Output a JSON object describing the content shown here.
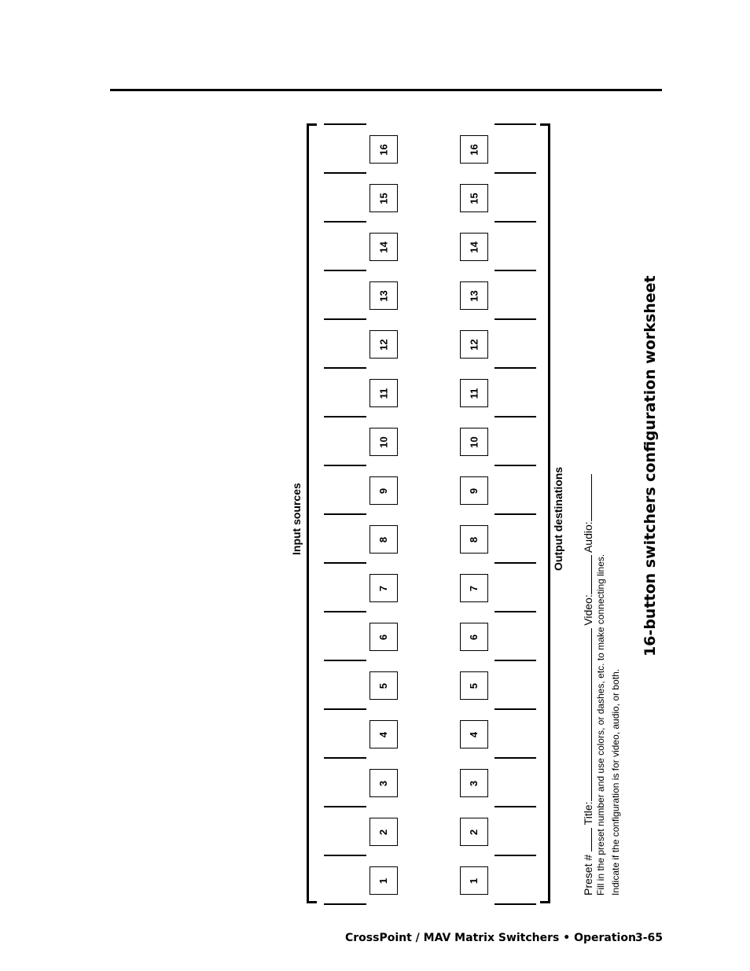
{
  "page": {
    "title": "16-button switchers configuration worksheet",
    "footer_text": "CrossPoint / MAV Matrix Switchers • Operation",
    "page_number": "3-65"
  },
  "worksheet": {
    "input_label": "Input  sources",
    "output_label": "Output destinations",
    "input_buttons": [
      "16",
      "15",
      "14",
      "13",
      "12",
      "11",
      "10",
      "9",
      "8",
      "7",
      "6",
      "5",
      "4",
      "3",
      "2",
      "1"
    ],
    "output_buttons": [
      "16",
      "15",
      "14",
      "13",
      "12",
      "11",
      "10",
      "9",
      "8",
      "7",
      "6",
      "5",
      "4",
      "3",
      "2",
      "1"
    ],
    "preset_label": "Preset #",
    "title_label": "Title:",
    "video_label": "Video:",
    "audio_label": "Audio:",
    "instruction_1": "Fill in the preset number and use colors, or dashes, etc. to make connecting lines.",
    "instruction_2": "Indicate if the configuration is for video, audio, or both."
  }
}
